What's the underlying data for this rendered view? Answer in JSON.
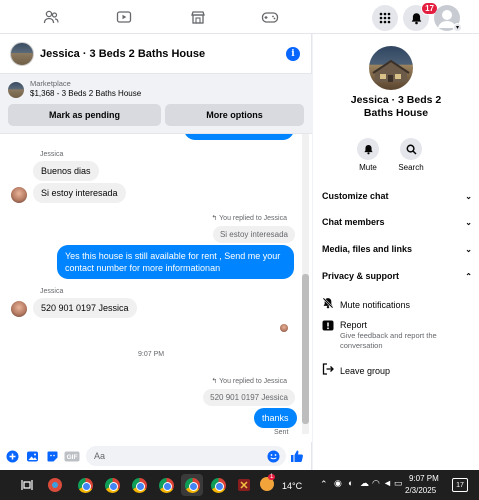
{
  "topbar": {
    "notifications_count": "17"
  },
  "chat": {
    "title": "Jessica · 3 Beds 2 Baths House",
    "marketplace": {
      "label": "Marketplace",
      "listing": "$1,368 - 3 Beds 2 Baths House",
      "mark_pending": "Mark as pending",
      "more_options": "More options"
    },
    "messages": {
      "sender1": "Jessica",
      "msg1": "Buenos dias",
      "msg2": "Si estoy interesada",
      "replied1": "You replied to Jessica",
      "quote1": "Si estoy interesada",
      "out1": "Yes this house is still available for rent , Send me your contact number for more informationan",
      "sender2": "Jessica",
      "msg3": "520 901 0197 Jessica",
      "time": "9:07 PM",
      "replied2": "You replied to Jessica",
      "quote2": "520 901 0197 Jessica",
      "out2": "thanks",
      "status": "Sent"
    },
    "composer": {
      "placeholder": "Aa"
    }
  },
  "side": {
    "title": "Jessica · 3 Beds 2 Baths House",
    "mute": "Mute",
    "search": "Search",
    "sections": [
      "Customize chat",
      "Chat members",
      "Media, files and links",
      "Privacy & support"
    ],
    "mute_notifications": "Mute notifications",
    "report": "Report",
    "report_desc": "Give feedback and report the conversation",
    "leave": "Leave group"
  },
  "taskbar": {
    "temp": "14°C",
    "time": "9:07 PM",
    "date": "2/3/2025",
    "weather_badge": "1",
    "notif_count": "17"
  },
  "colors": {
    "accent": "#0084ff",
    "badge": "#e41e3f"
  }
}
